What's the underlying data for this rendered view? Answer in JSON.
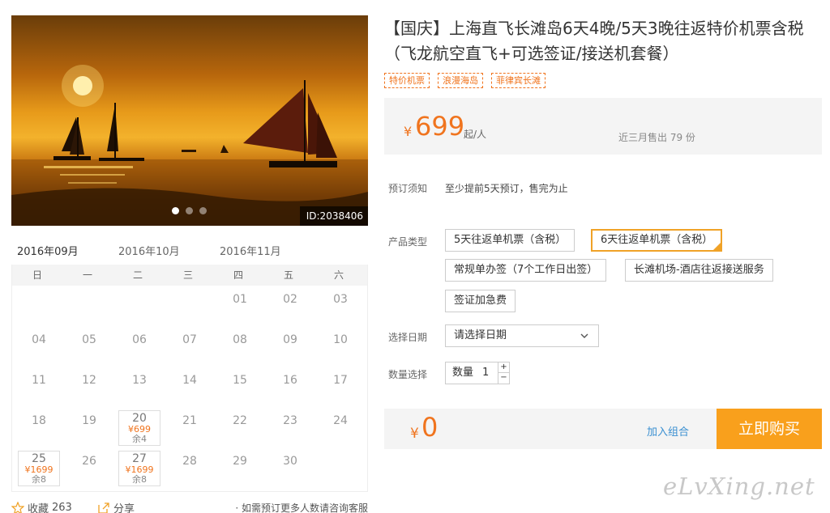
{
  "photo": {
    "id_label": "ID:2038406",
    "dots": 3,
    "active_dot": 0
  },
  "calendar": {
    "tabs": [
      "2016年09月",
      "2016年10月",
      "2016年11月"
    ],
    "active_tab": 0,
    "weekdays": [
      "日",
      "一",
      "二",
      "三",
      "四",
      "五",
      "六"
    ],
    "cells": [
      {
        "d": ""
      },
      {
        "d": ""
      },
      {
        "d": ""
      },
      {
        "d": ""
      },
      {
        "d": "01"
      },
      {
        "d": "02"
      },
      {
        "d": "03"
      },
      {
        "d": "04"
      },
      {
        "d": "05"
      },
      {
        "d": "06"
      },
      {
        "d": "07"
      },
      {
        "d": "08"
      },
      {
        "d": "09"
      },
      {
        "d": "10"
      },
      {
        "d": "11"
      },
      {
        "d": "12"
      },
      {
        "d": "13"
      },
      {
        "d": "14"
      },
      {
        "d": "15"
      },
      {
        "d": "16"
      },
      {
        "d": "17"
      },
      {
        "d": "18"
      },
      {
        "d": "19"
      },
      {
        "d": "20",
        "price": "¥699",
        "remain": "余4"
      },
      {
        "d": "21"
      },
      {
        "d": "22"
      },
      {
        "d": "23"
      },
      {
        "d": "24"
      },
      {
        "d": "25",
        "price": "¥1699",
        "remain": "余8"
      },
      {
        "d": "26"
      },
      {
        "d": "27",
        "price": "¥1699",
        "remain": "余8"
      },
      {
        "d": "28"
      },
      {
        "d": "29"
      },
      {
        "d": "30"
      },
      {
        "d": ""
      }
    ]
  },
  "footer": {
    "favorite_label": "收藏",
    "favorite_count": "263",
    "share_label": "分享",
    "note": "· 如需预订更多人数请咨询客服"
  },
  "product": {
    "title": "【国庆】上海直飞长滩岛6天4晚/5天3晚往返特价机票含税（飞龙航空直飞+可选签证/接送机套餐）",
    "tags": [
      "特价机票",
      "浪漫海岛",
      "菲律宾长滩"
    ],
    "price_currency": "¥",
    "price": "699",
    "price_unit": "起/人",
    "sold_text": "近三月售出 79 份",
    "notice_label": "预订须知",
    "notice_text": "至少提前5天预订，售完为止",
    "type_label": "产品类型",
    "types": [
      "5天往返单机票（含税）",
      "6天往返单机票（含税）",
      "常规单办签（7个工作日出签）",
      "长滩机场-酒店往返接送服务",
      "签证加急费"
    ],
    "selected_type": 1,
    "date_label": "选择日期",
    "date_placeholder": "请选择日期",
    "qty_label": "数量选择",
    "qty_inner_label": "数量",
    "qty_value": "1",
    "total_currency": "¥",
    "total": "0",
    "combo_label": "加入组合",
    "buy_label": "立即购买"
  },
  "watermark": "eLvXing.net",
  "colors": {
    "accent": "#f0741e",
    "buy": "#f9a01c",
    "link": "#3a8fd1"
  }
}
